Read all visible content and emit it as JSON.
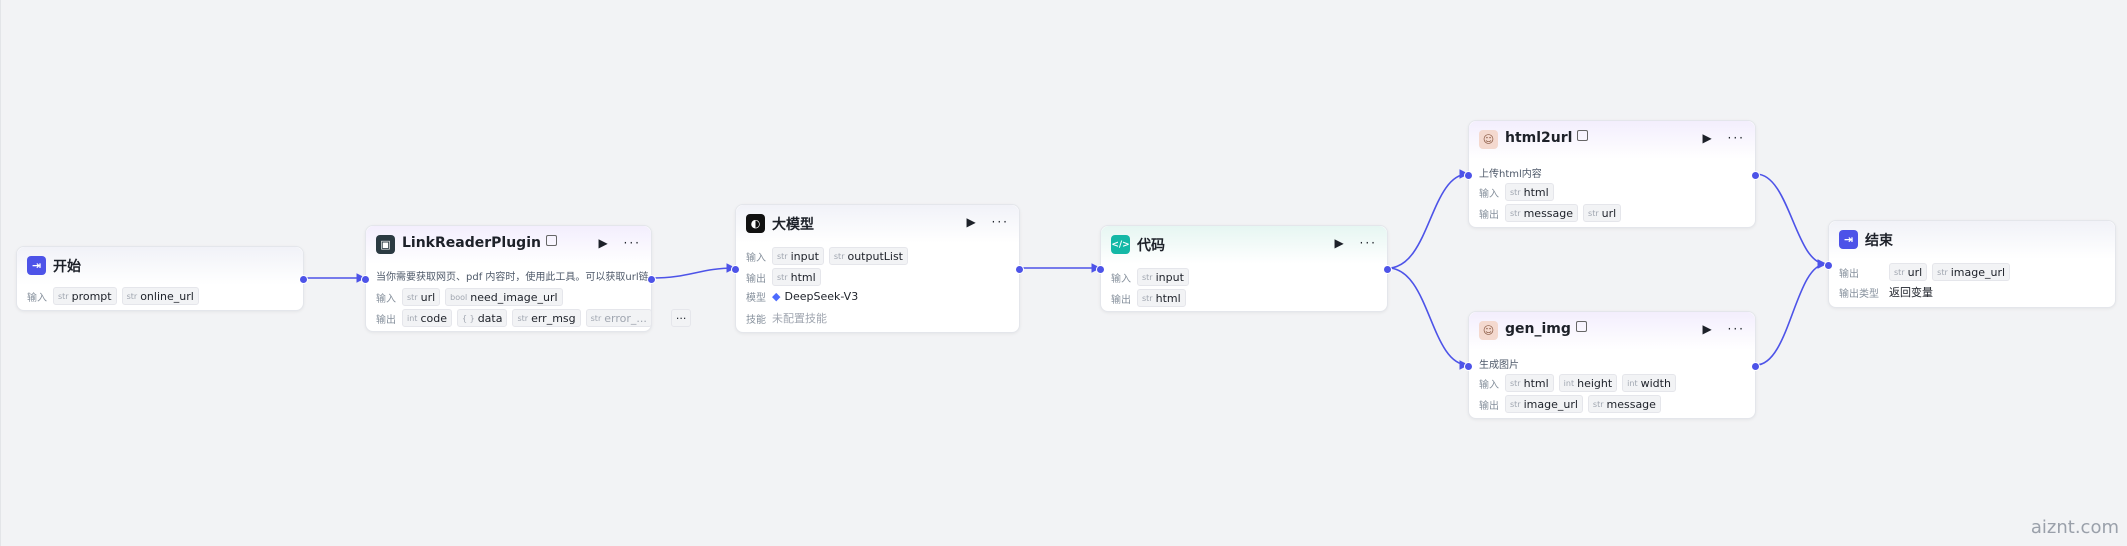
{
  "watermark": "aiznt.com",
  "nodes": {
    "start": {
      "title": "开始",
      "input_label": "输入",
      "inputs": [
        {
          "type": "str",
          "name": "prompt"
        },
        {
          "type": "str",
          "name": "online_url"
        }
      ]
    },
    "link_reader": {
      "title": "LinkReaderPlugin",
      "description": "当你需要获取网页、pdf 内容时，使用此工具。可以获取url链…",
      "input_label": "输入",
      "output_label": "输出",
      "inputs": [
        {
          "type": "str",
          "name": "url"
        },
        {
          "type": "bool",
          "name": "need_image_url"
        }
      ],
      "outputs": [
        {
          "type": "int",
          "name": "code"
        },
        {
          "type": "{ }",
          "name": "data"
        },
        {
          "type": "str",
          "name": "err_msg"
        },
        {
          "type": "str",
          "name": "error_..."
        }
      ],
      "more": "···"
    },
    "llm": {
      "title": "大模型",
      "input_label": "输入",
      "output_label": "输出",
      "model_label": "模型",
      "skill_label": "技能",
      "inputs": [
        {
          "type": "str",
          "name": "input"
        },
        {
          "type": "str",
          "name": "outputList"
        }
      ],
      "outputs": [
        {
          "type": "str",
          "name": "html"
        }
      ],
      "model": "DeepSeek-V3",
      "skill": "未配置技能"
    },
    "code": {
      "title": "代码",
      "input_label": "输入",
      "output_label": "输出",
      "inputs": [
        {
          "type": "str",
          "name": "input"
        }
      ],
      "outputs": [
        {
          "type": "str",
          "name": "html"
        }
      ]
    },
    "html2url": {
      "title": "html2url",
      "description": "上传html内容",
      "input_label": "输入",
      "output_label": "输出",
      "inputs": [
        {
          "type": "str",
          "name": "html"
        }
      ],
      "outputs": [
        {
          "type": "str",
          "name": "message"
        },
        {
          "type": "str",
          "name": "url"
        }
      ]
    },
    "gen_img": {
      "title": "gen_img",
      "description": "生成图片",
      "input_label": "输入",
      "output_label": "输出",
      "inputs": [
        {
          "type": "str",
          "name": "html"
        },
        {
          "type": "int",
          "name": "height"
        },
        {
          "type": "int",
          "name": "width"
        }
      ],
      "outputs": [
        {
          "type": "str",
          "name": "image_url"
        },
        {
          "type": "str",
          "name": "message"
        }
      ]
    },
    "end": {
      "title": "结束",
      "output_label": "输出",
      "output_type_label": "输出类型",
      "outputs": [
        {
          "type": "str",
          "name": "url"
        },
        {
          "type": "str",
          "name": "image_url"
        }
      ],
      "output_type": "返回变量"
    }
  },
  "actions": {
    "run": "▶",
    "menu": "···"
  },
  "colors": {
    "accent": "#4d53e8",
    "edge": "#4d53e8",
    "code_icon": "#14b8a6",
    "llm_icon": "#111111",
    "start_icon": "#4d53e8"
  }
}
